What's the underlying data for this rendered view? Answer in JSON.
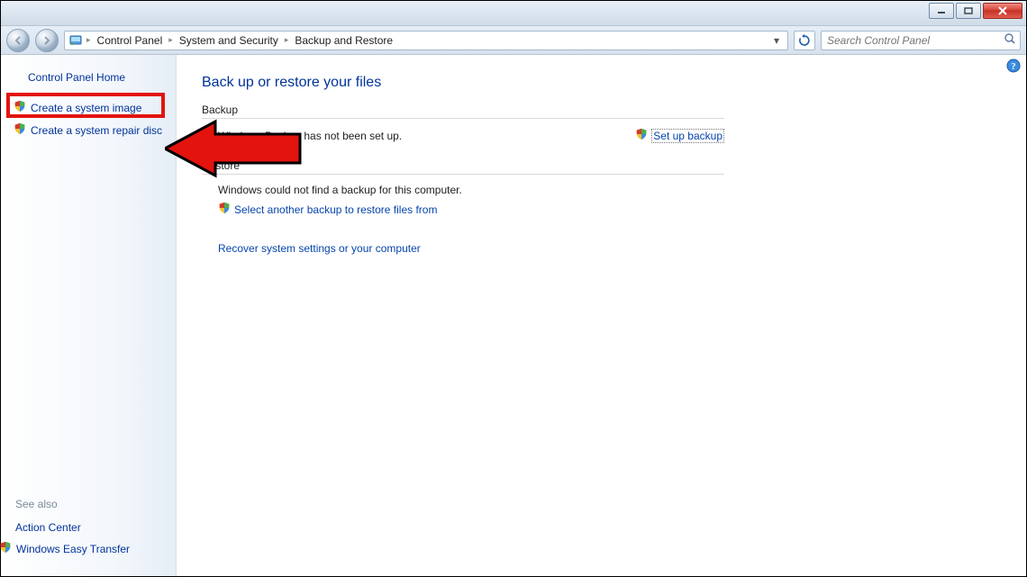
{
  "window": {
    "minimize": "minimize",
    "maximize": "maximize",
    "close": "close"
  },
  "breadcrumb": {
    "root_icon": "control-panel-icon",
    "items": [
      "Control Panel",
      "System and Security",
      "Backup and Restore"
    ]
  },
  "search": {
    "placeholder": "Search Control Panel"
  },
  "sidebar": {
    "home": "Control Panel Home",
    "tasks": [
      "Create a system image",
      "Create a system repair disc"
    ],
    "seealso_header": "See also",
    "seealso": [
      "Action Center",
      "Windows Easy Transfer"
    ]
  },
  "main": {
    "title": "Back up or restore your files",
    "backup_header": "Backup",
    "backup_status": "Windows Backup has not been set up.",
    "setup_link": "Set up backup",
    "restore_header": "Restore",
    "restore_status": "Windows could not find a backup for this computer.",
    "select_another": "Select another backup to restore files from",
    "recover_link": "Recover system settings or your computer"
  }
}
